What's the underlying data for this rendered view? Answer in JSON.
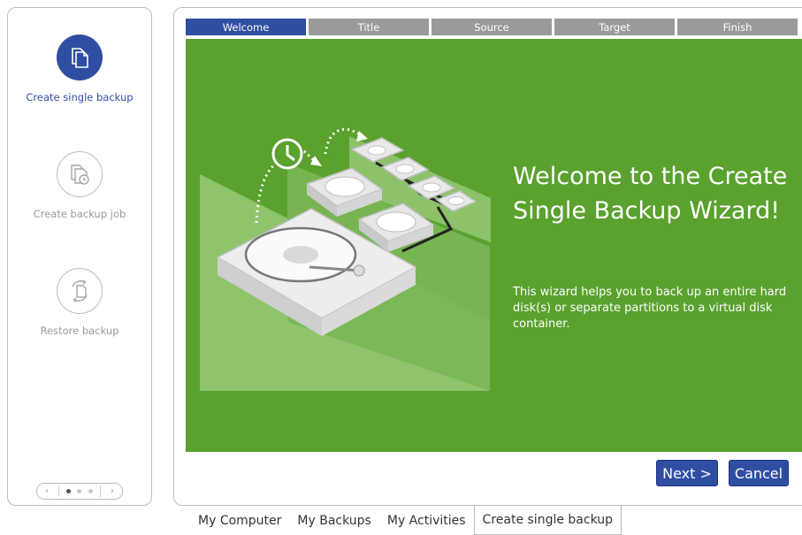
{
  "sidebar": {
    "items": [
      {
        "label": "Create single backup",
        "icon": "copy-documents-icon",
        "active": true
      },
      {
        "label": "Create backup job",
        "icon": "scheduled-documents-icon",
        "active": false
      },
      {
        "label": "Restore backup",
        "icon": "restore-document-icon",
        "active": false
      }
    ],
    "pager": {
      "prev": "‹",
      "next": "›",
      "pages": 3,
      "current": 1
    }
  },
  "wizard": {
    "steps": [
      "Welcome",
      "Title",
      "Source",
      "Target",
      "Finish"
    ],
    "active_step": "Welcome",
    "title": "Welcome to the Create Single Backup Wizard!",
    "description": "This wizard helps you to back up an entire hard disk(s) or separate partitions to a virtual disk container.",
    "next_label": "Next >",
    "cancel_label": "Cancel"
  },
  "tabs": [
    "My Computer",
    "My Backups",
    "My Activities",
    "Create single backup"
  ],
  "active_tab": "Create single backup",
  "colors": {
    "accent": "#2f4ea2",
    "content_bg": "#5aa12e",
    "step_inactive": "#9a9a9a"
  }
}
